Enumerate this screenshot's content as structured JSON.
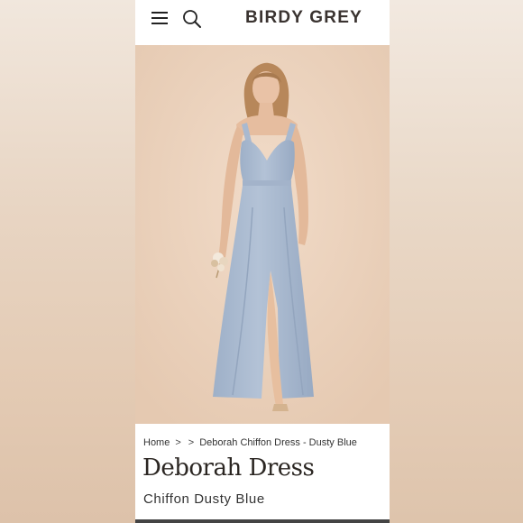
{
  "header": {
    "brand": "BIRDY GREY",
    "menu_icon": "hamburger-menu-icon",
    "search_icon": "search-icon"
  },
  "hero": {
    "image_alt": "Model wearing Deborah Chiffon Dress in Dusty Blue",
    "dress_color": "#a9b9cf",
    "background_color": "#ebd2bc"
  },
  "breadcrumb": {
    "home": "Home",
    "sep1": ">",
    "sep2": ">",
    "current": "Deborah Chiffon Dress - Dusty Blue"
  },
  "product": {
    "title": "Deborah Dress",
    "subtitle": "Chiffon Dusty Blue"
  },
  "colors": {
    "brand_text": "#3a3330",
    "page_background": "#ffffff"
  }
}
